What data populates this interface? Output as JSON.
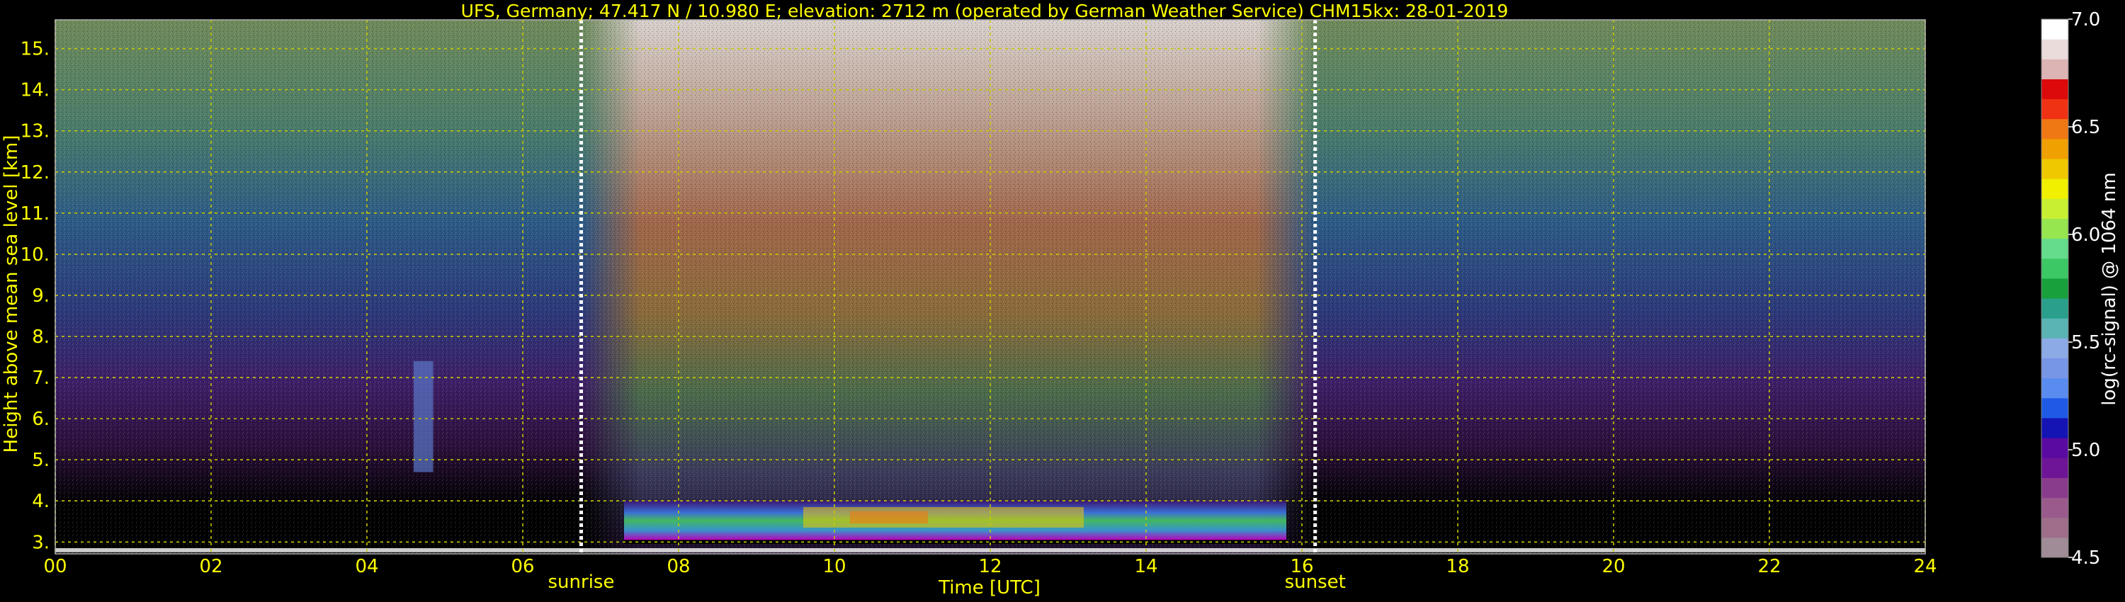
{
  "chart_data": {
    "type": "heatmap",
    "title": "UFS, Germany; 47.417 N / 10.980 E; elevation: 2712 m  (operated by German Weather Service)    CHM15kx: 28-01-2019",
    "xlabel": "Time [UTC]",
    "ylabel": "Height above mean sea level [km]",
    "xlim": [
      0,
      24
    ],
    "ylim": [
      2.712,
      15.7
    ],
    "x_ticks": [
      0,
      2,
      4,
      6,
      8,
      10,
      12,
      14,
      16,
      18,
      20,
      22,
      24
    ],
    "x_tick_labels": [
      "00",
      "02",
      "04",
      "06",
      "08",
      "10",
      "12",
      "14",
      "16",
      "18",
      "20",
      "22",
      "24"
    ],
    "y_ticks": [
      3,
      4,
      5,
      6,
      7,
      8,
      9,
      10,
      11,
      12,
      13,
      14,
      15
    ],
    "y_tick_labels": [
      "3.",
      "4.",
      "5.",
      "6.",
      "7.",
      "8.",
      "9.",
      "10.",
      "11.",
      "12.",
      "13.",
      "14.",
      "15."
    ],
    "grid": true,
    "annotations": [
      {
        "label": "sunrise",
        "x": 6.75
      },
      {
        "label": "sunset",
        "x": 16.17
      }
    ],
    "layers": [
      {
        "name": "boundary layer aerosol",
        "x_start": 7.3,
        "x_end": 15.8,
        "y_bottom": 3.05,
        "y_top": 4.0
      },
      {
        "name": "thin layer",
        "x_start": 4.6,
        "x_end": 4.85,
        "y_bottom": 4.7,
        "y_top": 7.4
      }
    ],
    "colorbar": {
      "label": "log(rc-signal) @ 1064 nm",
      "min": 4.5,
      "max": 7.0,
      "ticks": [
        4.5,
        5.0,
        5.5,
        6.0,
        6.5,
        7.0
      ],
      "tick_labels": [
        "4.5",
        "5.0",
        "5.5",
        "6.0",
        "6.5",
        "7.0"
      ],
      "colors": [
        "#a08c96",
        "#9e6e8a",
        "#9a5a8c",
        "#8a3c8c",
        "#6e1496",
        "#5a0aa0",
        "#1414b4",
        "#1e5ae6",
        "#5a8cf0",
        "#7896e6",
        "#8caae6",
        "#5ab4b4",
        "#2aa08c",
        "#18a03c",
        "#3cc864",
        "#64dc8c",
        "#96e650",
        "#c8f032",
        "#f0f000",
        "#f0c800",
        "#f0a000",
        "#f07814",
        "#f03214",
        "#dc0a0a",
        "#dcb4b4",
        "#ebdcdc",
        "#ffffff"
      ]
    }
  }
}
